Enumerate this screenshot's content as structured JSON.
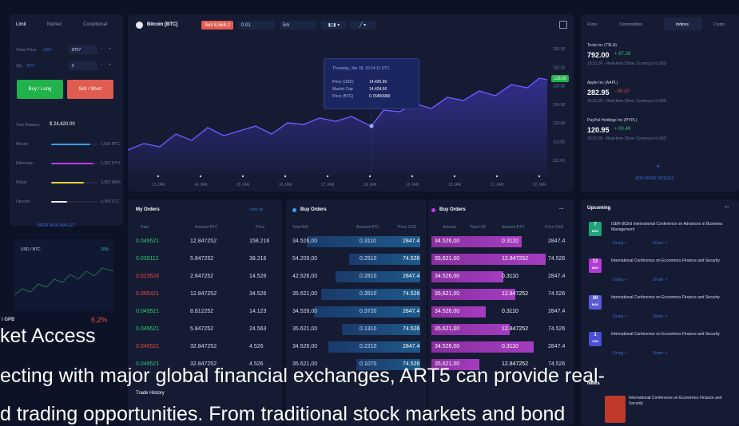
{
  "trade_panel": {
    "tabs": [
      "Limit",
      "Market",
      "Conditional"
    ],
    "order_price_label": "Order Price",
    "order_price_unit": "USD",
    "order_price_value": "8707",
    "qty_label": "Qty",
    "qty_unit": "BTC",
    "qty_value": "0",
    "buy_label": "Buy / Long",
    "sell_label": "Sell / Short",
    "balance_label": "Your Balance",
    "balance_value": "$ 24,620.00",
    "wallets": [
      {
        "name": "Bitcoin",
        "amount": "1,542 BTC",
        "color": "#3aa0ff",
        "fill": 0.85
      },
      {
        "name": "Ethereum",
        "amount": "2,352 ETH",
        "color": "#c03cf0",
        "fill": 0.92
      },
      {
        "name": "Maker",
        "amount": "3,352 MKR",
        "color": "#f0d23c",
        "fill": 0.7
      },
      {
        "name": "Litecoin",
        "amount": "0,365 LTC",
        "color": "#e8e8ee",
        "fill": 0.35
      }
    ],
    "open_wallet": "OPEN NEW WALLET",
    "mini_pair": "USD / BTC",
    "mini_change": "10%"
  },
  "chart": {
    "symbol": "Bitcoin [BTC]",
    "sell_badge": "Sell 8,568.2",
    "tool1": "0.01",
    "tool2": "5m",
    "tooltip_date": "Thursday, Jan 18, 20:14:11 UTC",
    "tooltip_rows": [
      {
        "k": "Price (USD)",
        "v": "14,425.90"
      },
      {
        "k": "Market Cap",
        "v": "14,424.50"
      },
      {
        "k": "Price (BTC)",
        "v": "0.76450990"
      }
    ],
    "current_badge": "128.00",
    "y_ticks": [
      "136.00",
      "132.00",
      "128.00",
      "124.00",
      "120.00",
      "116.00",
      "112.00"
    ],
    "x_ticks": [
      "13 JAN",
      "14 JAN",
      "15 JAN",
      "16 JAN",
      "17 JAN",
      "18 JAN",
      "19 JAN",
      "20 JAN",
      "21 JAN",
      "22 JAN"
    ]
  },
  "indices": {
    "tabs": [
      "Forex",
      "Commodities",
      "Indices",
      "Crypto"
    ],
    "items": [
      {
        "name": "Tesla Inc (TSLA)",
        "price": "792.00",
        "change": "+ 67.28",
        "meta": "19:31:36 - Real-time Cboe. Currency in USD",
        "color": "#2ecc71"
      },
      {
        "name": "Apple Inc (AAPL)",
        "price": "282.95",
        "change": "- 00.10",
        "meta": "19:31:36 - Real-time Cboe. Currency in USD",
        "color": "#e74c3c"
      },
      {
        "name": "PayPal Holdings Inc (PYPL)",
        "price": "120.95",
        "change": "+ 00.49",
        "meta": "19:31:36 - Real-time Cboe. Currency in USD",
        "color": "#2ecc71"
      }
    ],
    "add_more": "ADD MORE INDICES"
  },
  "my_orders": {
    "title": "My Orders",
    "view_all": "View all",
    "headers": [
      "Rate",
      "Amount BTC",
      "Price"
    ],
    "rows": [
      {
        "rate": "0.049521",
        "amount": "12.847252",
        "price": "158.216",
        "up": true
      },
      {
        "rate": "0.039112",
        "amount": "5.847252",
        "price": "38.216",
        "up": true
      },
      {
        "rate": "0.023524",
        "amount": "2.847252",
        "price": "14.526",
        "up": false
      },
      {
        "rate": "0.065421",
        "amount": "12.847252",
        "price": "34.526",
        "up": false
      },
      {
        "rate": "0.049521",
        "amount": "8.812252",
        "price": "14.123",
        "up": true
      },
      {
        "rate": "0.049521",
        "amount": "5.847252",
        "price": "24.563",
        "up": true
      },
      {
        "rate": "0.049521",
        "amount": "32.847252",
        "price": "4.526",
        "up": false
      },
      {
        "rate": "0.049521",
        "amount": "32.847252",
        "price": "4.526",
        "up": true
      }
    ]
  },
  "buy_orders": {
    "title": "Buy Orders",
    "headers": [
      "Total BID",
      "Amount BTC",
      "Price USD"
    ],
    "rows": [
      {
        "total": "34.526,00",
        "amount": "0.3110",
        "price": "2847.4",
        "fill": 0.85
      },
      {
        "total": "54.209,00",
        "amount": "0.2510",
        "price": "74.526",
        "fill": 0.55
      },
      {
        "total": "42.526,00",
        "amount": "0.2810",
        "price": "2847.4",
        "fill": 0.65
      },
      {
        "total": "35.621,00",
        "amount": "0.3510",
        "price": "74.526",
        "fill": 0.75
      },
      {
        "total": "34.526,00",
        "amount": "0.3720",
        "price": "2847.4",
        "fill": 0.8
      },
      {
        "total": "35.621,00",
        "amount": "0.1310",
        "price": "74.526",
        "fill": 0.6
      },
      {
        "total": "34.526,00",
        "amount": "0.2210",
        "price": "2847.4",
        "fill": 0.7
      },
      {
        "total": "35.621,00",
        "amount": "0.1070",
        "price": "74.526",
        "fill": 0.5
      }
    ]
  },
  "buy_orders_2": {
    "title": "Buy Orders",
    "headers": [
      "Amount",
      "Total ISD",
      "Amount BTC",
      "Price USD"
    ],
    "rows": [
      {
        "total": "34.526,00",
        "amount": "0.3110",
        "price": "2847.4",
        "fill": 0.75
      },
      {
        "total": "35,621,00",
        "amount": "12.847252",
        "price": "74.526",
        "fill": 0.95
      },
      {
        "total": "34.526,00",
        "amount": "0.3110",
        "price": "2847.4",
        "fill": 0.6
      },
      {
        "total": "35,621,00",
        "amount": "12.847252",
        "price": "74.526",
        "fill": 0.7
      },
      {
        "total": "34.526,00",
        "amount": "0.3110",
        "price": "2847.4",
        "fill": 0.45
      },
      {
        "total": "35,621,00",
        "amount": "12.847252",
        "price": "74.526",
        "fill": 0.65
      },
      {
        "total": "34.526,00",
        "amount": "0.3110",
        "price": "2847.4",
        "fill": 0.85
      },
      {
        "total": "35,621,00",
        "amount": "12.847252",
        "price": "74.526",
        "fill": 0.4
      }
    ]
  },
  "upcoming": {
    "title": "Upcoming",
    "events": [
      {
        "day": "7",
        "month": "MAY",
        "title": "ISER-803rd International Conference on Advances in Business Management",
        "color": "#1ea37a",
        "a": "Going",
        "b": "Share"
      },
      {
        "day": "12",
        "month": "MAY",
        "title": "International Conference on Economics Finance and Security",
        "color": "#b43ad6",
        "a": "Going",
        "b": "Share"
      },
      {
        "day": "30",
        "month": "MAY",
        "title": "International Conference on Economics Finance and Security",
        "color": "#5a5bd6",
        "a": "Going",
        "b": "Share"
      },
      {
        "day": "1",
        "month": "JUN",
        "title": "International Conference on Economics Finance and Security",
        "color": "#4a4fd6",
        "a": "Going",
        "b": "Share"
      }
    ]
  },
  "news": {
    "title": "News",
    "item_title": "International Conference on Economics Finance and Security"
  },
  "trade_history": {
    "title": "Trade History"
  },
  "overlay": {
    "mini_pair": "/ GPB",
    "mini_change": "6,2%",
    "heading": "ket Access",
    "line1": "ecting with major global financial exchanges, ART5 can provide real-",
    "line2": "d trading opportunities. From traditional stock markets and bond"
  }
}
